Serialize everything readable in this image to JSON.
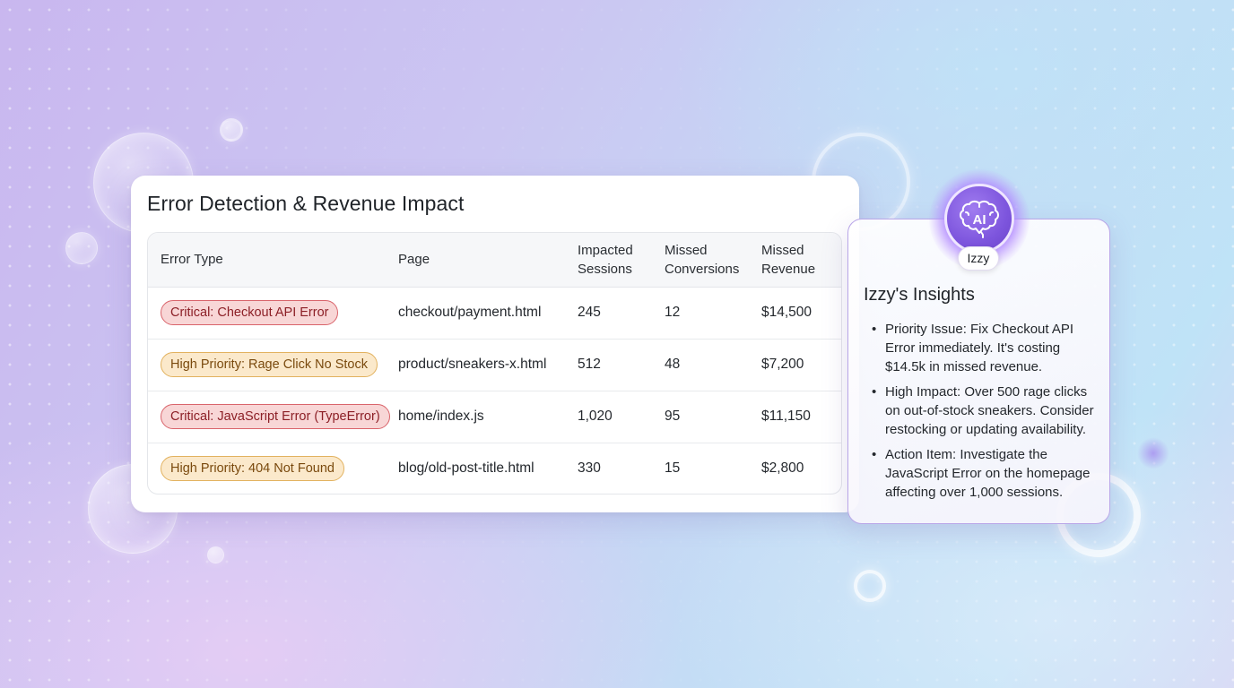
{
  "main": {
    "title": "Error Detection & Revenue Impact",
    "columns": [
      {
        "line1": "Error Type",
        "line2": ""
      },
      {
        "line1": "Page",
        "line2": ""
      },
      {
        "line1": "Impacted",
        "line2": "Sessions"
      },
      {
        "line1": "Missed",
        "line2": "Conversions"
      },
      {
        "line1": "Missed",
        "line2": "Revenue"
      }
    ],
    "rows": [
      {
        "error_type": "Critical: Checkout API Error",
        "severity": "critical",
        "page": "checkout/payment.html",
        "sessions": "245",
        "conversions": "12",
        "revenue": "$14,500"
      },
      {
        "error_type": "High Priority: Rage Click No Stock",
        "severity": "high",
        "page": "product/sneakers-x.html",
        "sessions": "512",
        "conversions": "48",
        "revenue": "$7,200"
      },
      {
        "error_type": "Critical: JavaScript Error (TypeError)",
        "severity": "critical",
        "page": "home/index.js",
        "sessions": "1,020",
        "conversions": "95",
        "revenue": "$11,150"
      },
      {
        "error_type": "High Priority: 404 Not Found",
        "severity": "high",
        "page": "blog/old-post-title.html",
        "sessions": "330",
        "conversions": "15",
        "revenue": "$2,800"
      }
    ]
  },
  "insights": {
    "avatar_label": "AI",
    "avatar_icon": "brain-icon",
    "name_tag": "Izzy",
    "title": "Izzy's Insights",
    "items": [
      "Priority Issue: Fix Checkout API Error immediately. It's costing $14.5k in missed revenue.",
      "High Impact: Over 500 rage clicks on out-of-stock sneakers. Consider restocking or updating availability.",
      "Action Item: Investigate the JavaScript Error on the homepage affecting over 1,000 sessions."
    ]
  },
  "colors": {
    "critical_bg": "#f8d6d6",
    "critical_border": "#d9646b",
    "high_bg": "#fbe9cb",
    "high_border": "#e2b25f",
    "avatar_purple": "#7d55dd"
  }
}
